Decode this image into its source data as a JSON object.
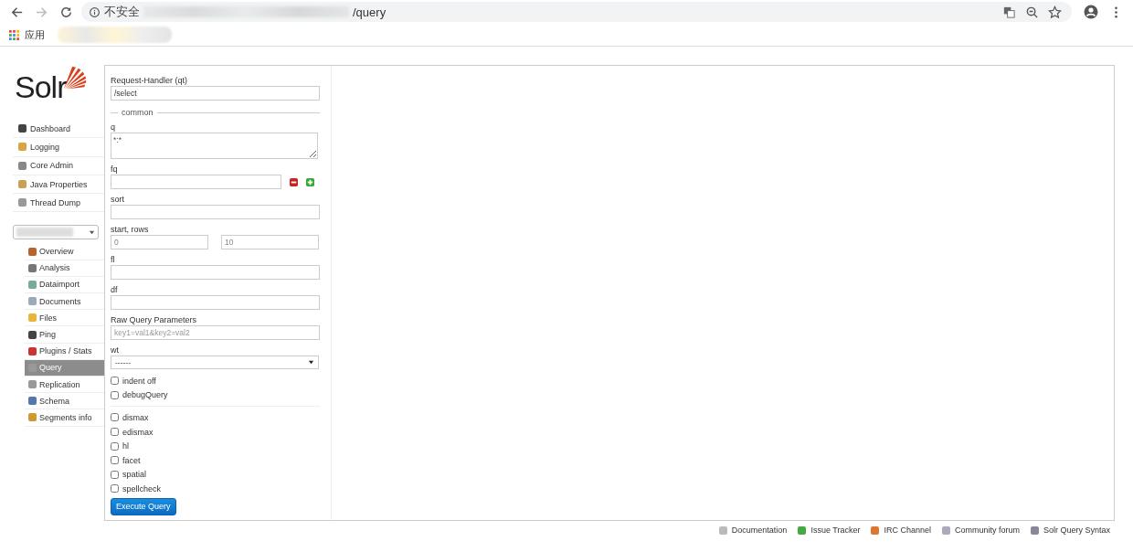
{
  "browser": {
    "security": "不安全",
    "path": "/query",
    "bookmarks": [
      "应用"
    ]
  },
  "sidebar": {
    "logo": "Solr",
    "items": [
      {
        "label": "Dashboard"
      },
      {
        "label": "Logging"
      },
      {
        "label": "Core Admin"
      },
      {
        "label": "Java Properties"
      },
      {
        "label": "Thread Dump"
      }
    ],
    "core_items": [
      {
        "label": "Overview",
        "selected": false
      },
      {
        "label": "Analysis",
        "selected": false
      },
      {
        "label": "Dataimport",
        "selected": false
      },
      {
        "label": "Documents",
        "selected": false
      },
      {
        "label": "Files",
        "selected": false
      },
      {
        "label": "Ping",
        "selected": false
      },
      {
        "label": "Plugins / Stats",
        "selected": false
      },
      {
        "label": "Query",
        "selected": true
      },
      {
        "label": "Replication",
        "selected": false
      },
      {
        "label": "Schema",
        "selected": false
      },
      {
        "label": "Segments info",
        "selected": false
      }
    ]
  },
  "form": {
    "handler": {
      "label": "Request-Handler (qt)",
      "value": "/select"
    },
    "legend": "common",
    "fields": [
      {
        "kind": "textarea",
        "label": "q",
        "value": "*:*"
      },
      {
        "kind": "fq",
        "label": "fq"
      },
      {
        "kind": "text",
        "label": "sort"
      },
      {
        "kind": "pair",
        "label": "start, rows",
        "values": [
          "0",
          "10"
        ]
      },
      {
        "kind": "text",
        "label": "fl"
      },
      {
        "kind": "text",
        "label": "df"
      },
      {
        "kind": "text",
        "label": "Raw Query Parameters",
        "placeholder": "key1=val1&key2=val2"
      },
      {
        "kind": "select",
        "label": "wt",
        "value": "------"
      }
    ],
    "options": [
      {
        "label": "indent off",
        "checked": false
      },
      {
        "label": "debugQuery",
        "checked": false
      }
    ],
    "parsers": [
      {
        "label": "dismax",
        "checked": false
      },
      {
        "label": "edismax",
        "checked": false
      },
      {
        "label": "hl",
        "checked": false
      },
      {
        "label": "facet",
        "checked": false
      },
      {
        "label": "spatial",
        "checked": false
      },
      {
        "label": "spellcheck",
        "checked": false
      }
    ],
    "button": "Execute Query"
  },
  "footer": [
    "Documentation",
    "Issue Tracker",
    "IRC Channel",
    "Community forum",
    "Solr Query Syntax"
  ]
}
